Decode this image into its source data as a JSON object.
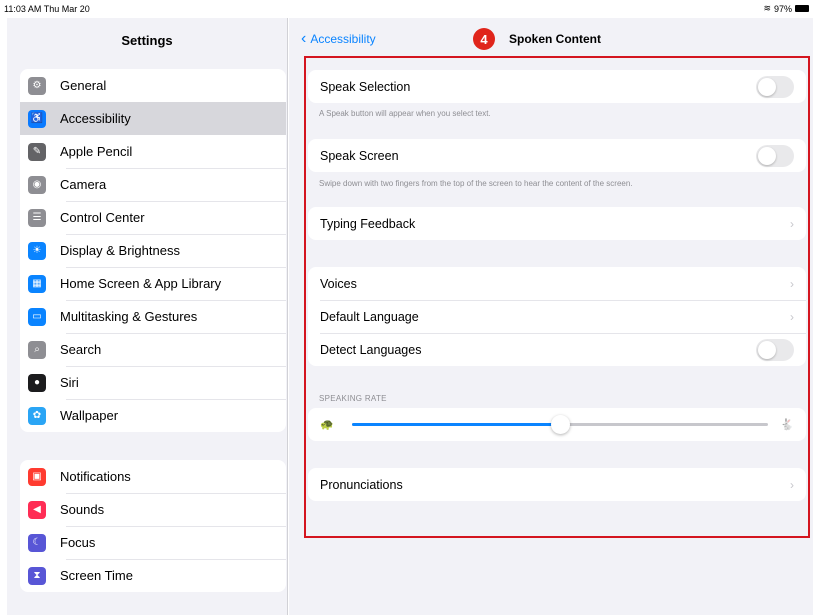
{
  "status_bar": {
    "time": "11:03 AM  Thu Mar 20",
    "battery": "97%"
  },
  "sidebar": {
    "title": "Settings",
    "group1": [
      {
        "label": "General",
        "icon": "gear-icon",
        "color": "#8e8e93",
        "glyph": "⚙"
      },
      {
        "label": "Accessibility",
        "icon": "accessibility-icon",
        "color": "#0a7aff",
        "glyph": "♿",
        "selected": true
      },
      {
        "label": "Apple Pencil",
        "icon": "pencil-icon",
        "color": "#636366",
        "glyph": "✎"
      },
      {
        "label": "Camera",
        "icon": "camera-icon",
        "color": "#8e8e93",
        "glyph": "◉"
      },
      {
        "label": "Control Center",
        "icon": "control-center-icon",
        "color": "#8e8e93",
        "glyph": "☰"
      },
      {
        "label": "Display & Brightness",
        "icon": "brightness-icon",
        "color": "#0a84ff",
        "glyph": "☀"
      },
      {
        "label": "Home Screen & App Library",
        "icon": "home-screen-icon",
        "color": "#0a84ff",
        "glyph": "▦"
      },
      {
        "label": "Multitasking & Gestures",
        "icon": "multitasking-icon",
        "color": "#0a84ff",
        "glyph": "▭"
      },
      {
        "label": "Search",
        "icon": "search-icon",
        "color": "#8e8e93",
        "glyph": "⌕"
      },
      {
        "label": "Siri",
        "icon": "siri-icon",
        "color": "#1c1c1e",
        "glyph": "●"
      },
      {
        "label": "Wallpaper",
        "icon": "wallpaper-icon",
        "color": "#2aa5f5",
        "glyph": "✿"
      }
    ],
    "group2": [
      {
        "label": "Notifications",
        "icon": "notifications-icon",
        "color": "#ff3b30",
        "glyph": "▣"
      },
      {
        "label": "Sounds",
        "icon": "sounds-icon",
        "color": "#ff2d55",
        "glyph": "◀"
      },
      {
        "label": "Focus",
        "icon": "focus-icon",
        "color": "#5856d6",
        "glyph": "☾"
      },
      {
        "label": "Screen Time",
        "icon": "screen-time-icon",
        "color": "#5856d6",
        "glyph": "⧗"
      }
    ]
  },
  "detail": {
    "back_label": "Accessibility",
    "title": "Spoken Content",
    "badge": "4",
    "speak_selection": {
      "label": "Speak Selection",
      "on": false,
      "footnote": "A Speak button will appear when you select text."
    },
    "speak_screen": {
      "label": "Speak Screen",
      "on": false,
      "footnote": "Swipe down with two fingers from the top of the screen to hear the content of the screen."
    },
    "typing_feedback": "Typing Feedback",
    "voices": "Voices",
    "default_language": "Default Language",
    "detect_languages": {
      "label": "Detect Languages",
      "on": false
    },
    "speaking_rate": {
      "header": "SPEAKING RATE",
      "value": 0.5
    },
    "pronunciations": "Pronunciations"
  },
  "colors": {
    "accent": "#0a84ff",
    "highlight": "#d4151f"
  }
}
